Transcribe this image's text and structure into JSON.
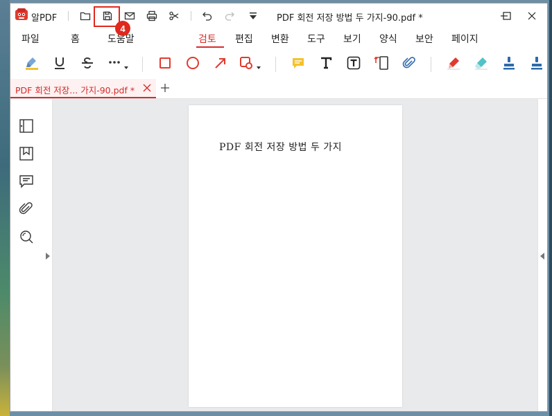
{
  "app": {
    "name": "알PDF"
  },
  "window": {
    "title": "PDF 회전 저장 방법 두 가지-90.pdf *"
  },
  "tutorial": {
    "step_badge": "4"
  },
  "menu": {
    "items": [
      {
        "label": "파일"
      },
      {
        "label": "홈"
      },
      {
        "label": "도움말"
      },
      {
        "label": "검토"
      },
      {
        "label": "편집"
      },
      {
        "label": "변환"
      },
      {
        "label": "도구"
      },
      {
        "label": "보기"
      },
      {
        "label": "양식"
      },
      {
        "label": "보안"
      },
      {
        "label": "페이지"
      }
    ],
    "active": "검토"
  },
  "tabs": [
    {
      "label": "PDF 회전 저장... 가지-90.pdf *"
    }
  ],
  "document": {
    "page_text": "PDF 회전 저장 방법 두 가지"
  },
  "colors": {
    "accent": "#d62b2b",
    "highlight_box": "#e0281c"
  }
}
